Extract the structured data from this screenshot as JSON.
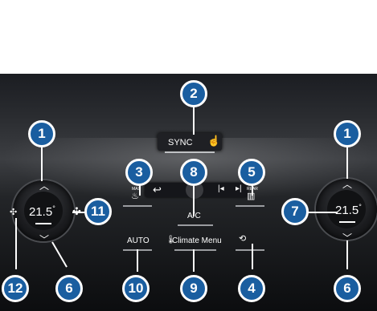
{
  "colors": {
    "callout_fill": "#1a5ea0",
    "callout_border": "#ffffff",
    "panel_dark": "#0c0d0f",
    "text": "#ffffff"
  },
  "top_bar": {
    "sync_label": "SYNC",
    "touch_icon": "hand-touch-icon"
  },
  "left_zone": {
    "temperature_value": "21.5",
    "temperature_unit": "°",
    "fan_icon": "fan-icon",
    "up_icon": "chevron-up-icon",
    "down_icon": "chevron-down-icon"
  },
  "right_zone": {
    "temperature_value": "21.5",
    "temperature_unit": "°",
    "up_icon": "chevron-up-icon",
    "down_icon": "chevron-down-icon"
  },
  "media": {
    "back_icon": "back-arrow-icon",
    "prev_icon": "skip-previous-icon",
    "next_icon": "skip-next-icon"
  },
  "controls": {
    "max_defrost_caption": "MAX",
    "rear_defrost_caption": "REAR",
    "ac_label": "A/C",
    "auto_label": "AUTO",
    "climate_menu_label": "Climate Menu",
    "recirculation_icon": "air-recirculation-icon"
  },
  "callouts": {
    "left_up": "1",
    "right_up": "1",
    "sync": "2",
    "max_defrost": "3",
    "recirculation": "4",
    "rear_defrost": "5",
    "left_down": "6",
    "right_down": "6",
    "right_temp": "7",
    "ac": "8",
    "climate_menu": "9",
    "auto": "10",
    "fan_speed": "11",
    "fan_low": "12"
  }
}
